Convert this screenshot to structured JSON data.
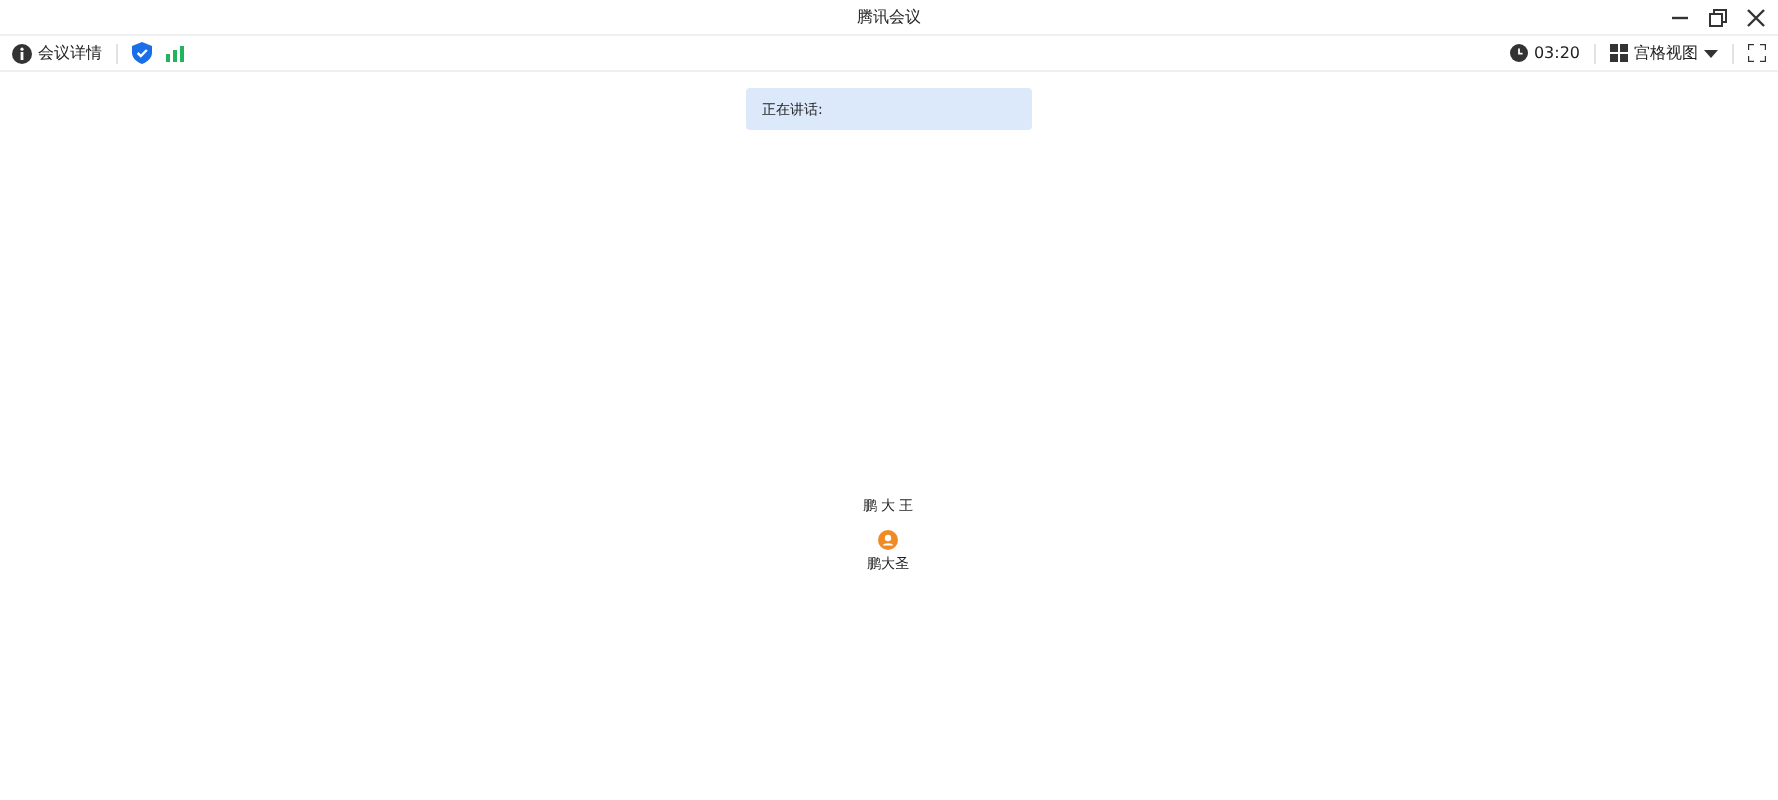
{
  "window": {
    "title": "腾讯会议"
  },
  "toolbar": {
    "meeting_info": "会议详情",
    "timer": "03:20",
    "view": "宫格视图"
  },
  "speaking": {
    "label": "正在讲话:"
  },
  "participant": {
    "video_name": "鹏 大 王",
    "name": "鹏大圣"
  }
}
